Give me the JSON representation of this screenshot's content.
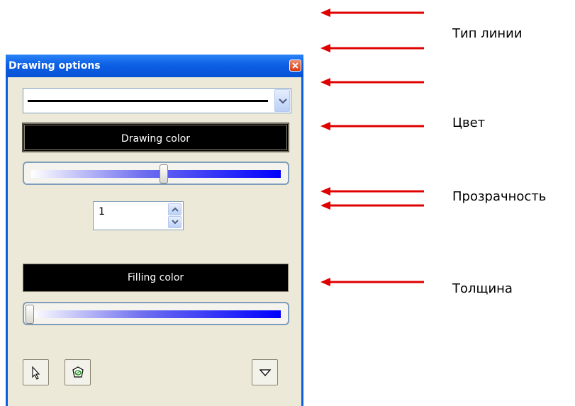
{
  "window": {
    "title": "Drawing options"
  },
  "line_type": {
    "selected": "solid line"
  },
  "drawing_color": {
    "label": "Drawing color",
    "transparency_level": 0.53
  },
  "thickness_spinner": {
    "value": "1"
  },
  "filling_color": {
    "label": "Filling color",
    "transparency_level": 0.0
  },
  "toolbar": {
    "icons": [
      "pointer-icon",
      "fill-bucket-icon",
      "dropdown-triangle-icon"
    ]
  },
  "annotations": {
    "arrow_color": "#e00000",
    "labels": [
      "Тип линии",
      "Цвет",
      "Прозрачность",
      "Толщина"
    ]
  },
  "colors": {
    "title_bar": "#0d5fe4",
    "panel_bg": "#ece9d8",
    "slider_end": "#0000ff"
  }
}
